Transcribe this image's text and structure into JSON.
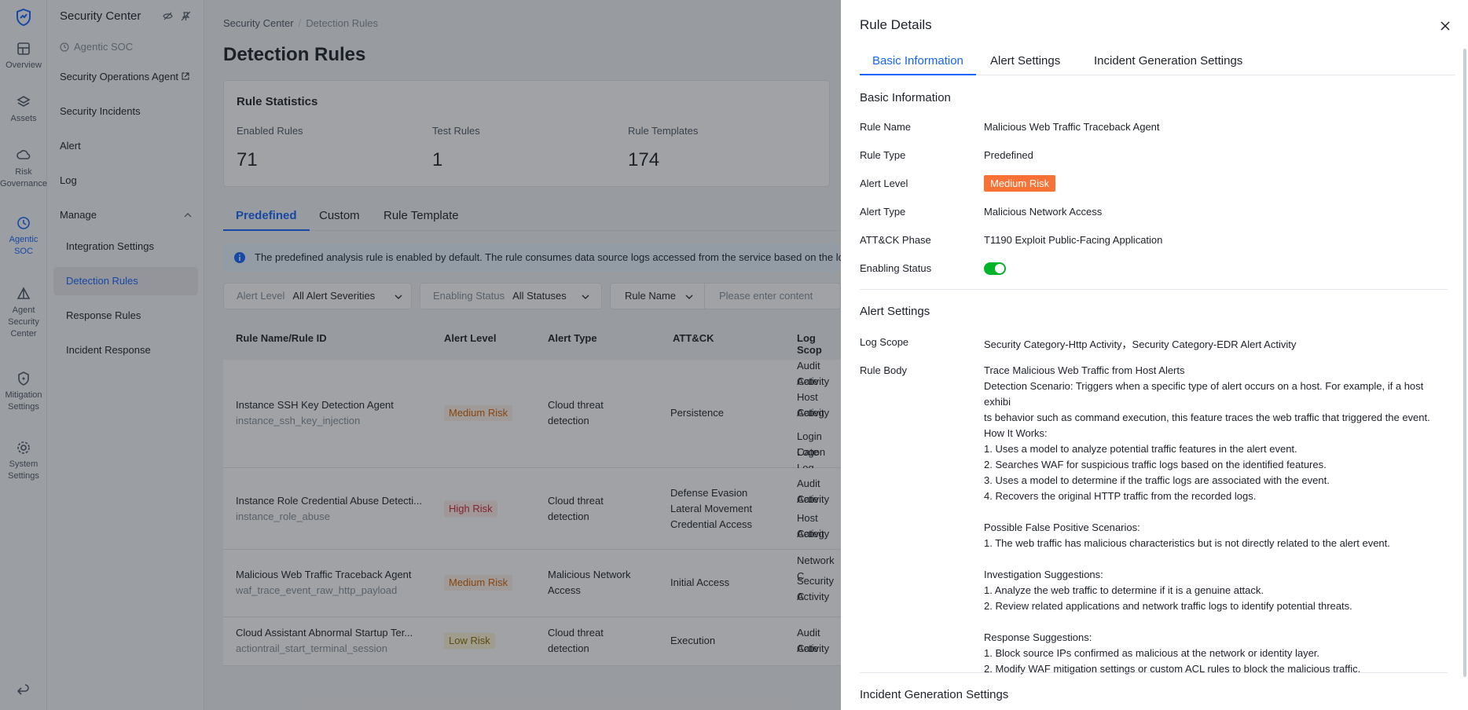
{
  "rail": {
    "items": [
      {
        "label": "Overview",
        "icon": "dashboard-icon"
      },
      {
        "label": "Assets",
        "icon": "layers-icon"
      },
      {
        "label": "Risk Governance",
        "icon": "cloud-icon"
      },
      {
        "label": "Agentic SOC",
        "icon": "shield-clock-icon"
      },
      {
        "label": "Agent Security Center",
        "icon": "triangle-icon"
      },
      {
        "label": "Mitigation Settings",
        "icon": "shield-icon"
      },
      {
        "label": "System Settings",
        "icon": "gear-icon"
      }
    ]
  },
  "nav": {
    "title": "Security Center",
    "subtitle": "Agentic SOC",
    "items": [
      "Security Operations Agent",
      "Security Incidents",
      "Alert",
      "Log"
    ],
    "group": "Manage",
    "children": [
      "Integration Settings",
      "Detection Rules",
      "Response Rules",
      "Incident Response"
    ]
  },
  "main": {
    "breadcrumb": [
      "Security Center",
      "Detection Rules"
    ],
    "title": "Detection Rules",
    "stats": {
      "title": "Rule Statistics",
      "items": [
        {
          "label": "Enabled Rules",
          "value": "71"
        },
        {
          "label": "Test Rules",
          "value": "1"
        },
        {
          "label": "Rule Templates",
          "value": "174"
        }
      ]
    },
    "tabs": [
      "Predefined",
      "Custom",
      "Rule Template"
    ],
    "notice": "The predefined analysis rule is enabled by default. The rule consumes data source logs accessed from the service based on the log",
    "filters": {
      "alert_level_key": "Alert Level",
      "alert_level_value": "All Alert Severities",
      "enabling_status_key": "Enabling Status",
      "enabling_status_value": "All Statuses",
      "rule_name_key": "Rule Name",
      "search_placeholder": "Please enter content"
    },
    "table": {
      "headers": [
        "Rule Name/Rule ID",
        "Alert Level",
        "Alert Type",
        "ATT&CK",
        "Log Scop"
      ],
      "rows": [
        {
          "name": "Instance SSH Key Detection Agent",
          "id": "instance_ssh_key_injection",
          "level": "Medium Risk",
          "type1": "Cloud threat",
          "type2": "detection",
          "attck": [
            "Persistence"
          ],
          "scope": [
            "Audit Cate",
            "Activity",
            "Host Categ",
            "Activity",
            "Login Cate",
            "Logon Log"
          ]
        },
        {
          "name": "Instance Role Credential Abuse Detecti...",
          "id": "instance_role_abuse",
          "level": "High Risk",
          "type1": "Cloud threat",
          "type2": "detection",
          "attck": [
            "Defense Evasion",
            "Lateral Movement",
            "Credential Access"
          ],
          "scope": [
            "Audit Cate",
            "Activity",
            "Host Categ",
            "Activity"
          ]
        },
        {
          "name": "Malicious Web Traffic Traceback Agent",
          "id": "waf_trace_event_raw_http_payload",
          "level": "Medium Risk",
          "type1": "Malicious Network",
          "type2": "Access",
          "attck": [
            "Initial Access"
          ],
          "scope": [
            "Network C",
            "Security C",
            "Activity"
          ]
        },
        {
          "name": "Cloud Assistant Abnormal Startup Ter...",
          "id": "actiontrail_start_terminal_session",
          "level": "Low Risk",
          "type1": "Cloud threat",
          "type2": "detection",
          "attck": [
            "Execution"
          ],
          "scope": [
            "Audit Cate",
            "Activity"
          ]
        }
      ]
    }
  },
  "drawer": {
    "title": "Rule Details",
    "tabs": [
      "Basic Information",
      "Alert Settings",
      "Incident Generation Settings"
    ],
    "basic": {
      "title": "Basic Information",
      "rule_name_label": "Rule Name",
      "rule_name": "Malicious Web Traffic Traceback Agent",
      "rule_type_label": "Rule Type",
      "rule_type": "Predefined",
      "alert_level_label": "Alert Level",
      "alert_level": "Medium Risk",
      "alert_type_label": "Alert Type",
      "alert_type": "Malicious Network Access",
      "attck_label": "ATT&CK Phase",
      "attck": "T1190 Exploit Public-Facing Application",
      "enabling_label": "Enabling Status",
      "enabled": true
    },
    "alert": {
      "title": "Alert Settings",
      "log_scope_label": "Log Scope",
      "log_scope": "Security Category-Http Activity，Security Category-EDR Alert Activity",
      "rule_body_label": "Rule Body",
      "rule_body": [
        "Trace Malicious Web Traffic from Host Alerts",
        "Detection Scenario: Triggers when a specific type of alert occurs on a host. For example, if a host exhibi",
        "ts behavior such as command execution, this feature traces the web traffic that triggered the event.",
        "How It Works:",
        "1. Uses a model to analyze potential traffic features in the alert event.",
        "2. Searches WAF for suspicious traffic logs based on the identified features.",
        "3. Uses a model to determine if the traffic logs are associated with the event.",
        "4. Recovers the original HTTP traffic from the recorded logs.",
        "",
        "Possible False Positive Scenarios:",
        "1. The web traffic has malicious characteristics but is not directly related to the alert event.",
        "",
        "Investigation Suggestions:",
        "1. Analyze the web traffic to determine if it is a genuine attack.",
        "2. Review related applications and network traffic logs to identify potential threats.",
        "",
        "Response Suggestions:",
        "1. Block source IPs confirmed as malicious at the network or identity layer.",
        "2. Modify WAF mitigation settings or custom ACL rules to block the malicious traffic."
      ]
    },
    "incident": {
      "title": "Incident Generation Settings"
    }
  },
  "colors": {
    "accent": "#1664ff",
    "medium_risk": "#f77234",
    "toggle_on": "#00b42a"
  }
}
